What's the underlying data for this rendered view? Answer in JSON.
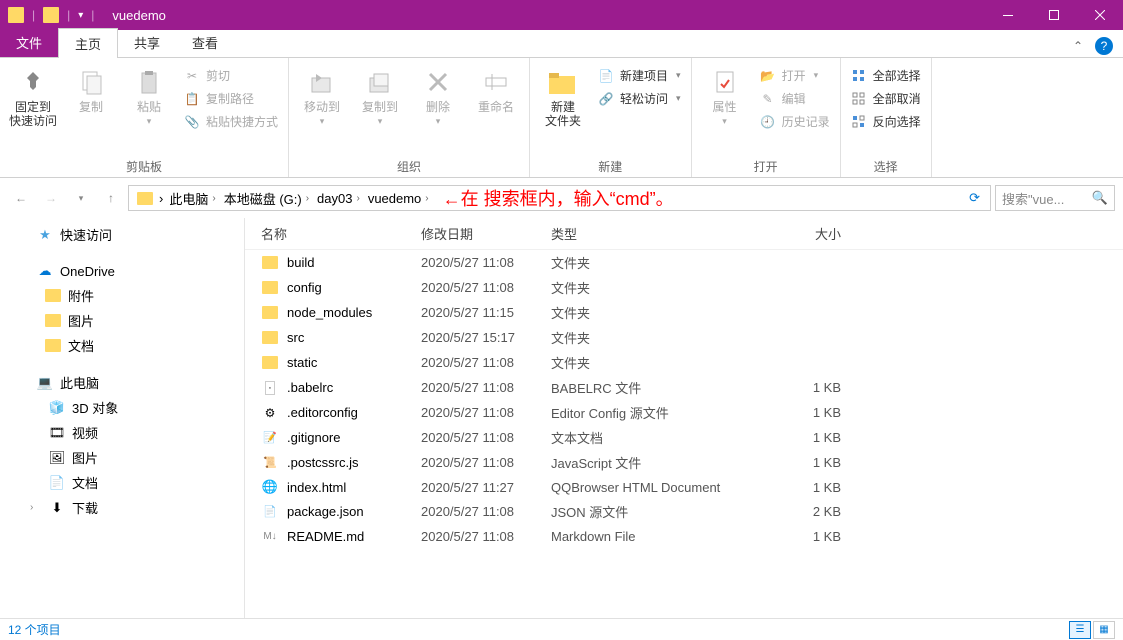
{
  "titlebar": {
    "title": "vuedemo"
  },
  "tabs": {
    "file": "文件",
    "home": "主页",
    "share": "共享",
    "view": "查看"
  },
  "ribbon": {
    "clipboard": {
      "label": "剪贴板",
      "pin": "固定到\n快速访问",
      "copy": "复制",
      "paste": "粘贴",
      "cut": "剪切",
      "copypath": "复制路径",
      "pasteshort": "粘贴快捷方式"
    },
    "organize": {
      "label": "组织",
      "moveto": "移动到",
      "copyto": "复制到",
      "delete": "删除",
      "rename": "重命名"
    },
    "new": {
      "label": "新建",
      "newfolder": "新建\n文件夹",
      "newitem": "新建项目",
      "easyaccess": "轻松访问"
    },
    "open": {
      "label": "打开",
      "properties": "属性",
      "open": "打开",
      "edit": "编辑",
      "history": "历史记录"
    },
    "select": {
      "label": "选择",
      "selectall": "全部选择",
      "selectnone": "全部取消",
      "invert": "反向选择"
    }
  },
  "breadcrumbs": [
    "此电脑",
    "本地磁盘 (G:)",
    "day03",
    "vuedemo"
  ],
  "annotation": "在 搜索框内，输入“cmd”。",
  "search": {
    "placeholder": "搜索\"vue..."
  },
  "sidebar": {
    "quick": "快速访问",
    "onedrive": "OneDrive",
    "onedrive_items": [
      "附件",
      "图片",
      "文档"
    ],
    "thispc": "此电脑",
    "thispc_items": [
      "3D 对象",
      "视频",
      "图片",
      "文档",
      "下载"
    ]
  },
  "columns": {
    "name": "名称",
    "date": "修改日期",
    "type": "类型",
    "size": "大小"
  },
  "files": [
    {
      "name": "build",
      "date": "2020/5/27 11:08",
      "type": "文件夹",
      "size": "",
      "icon": "folder"
    },
    {
      "name": "config",
      "date": "2020/5/27 11:08",
      "type": "文件夹",
      "size": "",
      "icon": "folder"
    },
    {
      "name": "node_modules",
      "date": "2020/5/27 11:15",
      "type": "文件夹",
      "size": "",
      "icon": "folder"
    },
    {
      "name": "src",
      "date": "2020/5/27 15:17",
      "type": "文件夹",
      "size": "",
      "icon": "folder"
    },
    {
      "name": "static",
      "date": "2020/5/27 11:08",
      "type": "文件夹",
      "size": "",
      "icon": "folder"
    },
    {
      "name": ".babelrc",
      "date": "2020/5/27 11:08",
      "type": "BABELRC 文件",
      "size": "1 KB",
      "icon": "file"
    },
    {
      "name": ".editorconfig",
      "date": "2020/5/27 11:08",
      "type": "Editor Config 源文件",
      "size": "1 KB",
      "icon": "gear"
    },
    {
      "name": ".gitignore",
      "date": "2020/5/27 11:08",
      "type": "文本文档",
      "size": "1 KB",
      "icon": "txt"
    },
    {
      "name": ".postcssrc.js",
      "date": "2020/5/27 11:08",
      "type": "JavaScript 文件",
      "size": "1 KB",
      "icon": "js"
    },
    {
      "name": "index.html",
      "date": "2020/5/27 11:27",
      "type": "QQBrowser HTML Document",
      "size": "1 KB",
      "icon": "html"
    },
    {
      "name": "package.json",
      "date": "2020/5/27 11:08",
      "type": "JSON 源文件",
      "size": "2 KB",
      "icon": "json"
    },
    {
      "name": "README.md",
      "date": "2020/5/27 11:08",
      "type": "Markdown File",
      "size": "1 KB",
      "icon": "md"
    }
  ],
  "status": "12 个项目"
}
